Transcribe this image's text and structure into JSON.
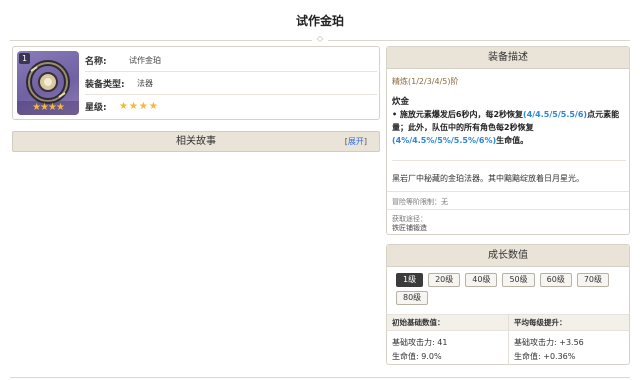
{
  "page": {
    "title": "试作金珀"
  },
  "item": {
    "rank": "1",
    "fields": [
      {
        "label": "名称:",
        "value": "试作金珀"
      },
      {
        "label": "装备类型:",
        "value": "法器"
      },
      {
        "label": "星级:",
        "value": ""
      }
    ],
    "rarity_stars": 4,
    "stars_text": "★★★★"
  },
  "story": {
    "title": "相关故事",
    "expand_open": "[",
    "expand_label": "展开",
    "expand_close": "]"
  },
  "description": {
    "header": "装备描述",
    "refinement": "精炼(1/2/3/4/5)阶",
    "passive_name": "炊金",
    "passive_parts": [
      {
        "text": "• 施放元素爆发后6秒内，每2秒恢复",
        "highlight": false
      },
      {
        "text": "(4/4.5/5/5.5/6)",
        "highlight": true
      },
      {
        "text": "点元素能量；此外，队伍中的所有角色每2秒恢复",
        "highlight": false
      },
      {
        "text": "(4%/4.5%/5%/5.5%/6%)",
        "highlight": true
      },
      {
        "text": "生命值。",
        "highlight": false
      }
    ],
    "flavor": "黑岩厂中秘藏的金珀法器。其中黯黯绽放着日月星光。",
    "ascension": "冒险等阶限制：无",
    "source_label": "获取途径：",
    "source_value": "铁匠铺锻造"
  },
  "growth": {
    "header": "成长数值",
    "levels": [
      "1级",
      "20级",
      "40级",
      "50级",
      "60级",
      "70级",
      "80级"
    ],
    "active_level": "1级",
    "base_header": "初始基础数值：",
    "growth_header": "平均每级提升：",
    "base_values": [
      "基础攻击力: 41",
      "生命值: 9.0%"
    ],
    "growth_values": [
      "基础攻击力: +3.56",
      "生命值: +0.36%"
    ]
  },
  "colors": {
    "accent_highlight": "#2d86d6",
    "star": "#f2b83a",
    "panel_header_bg": "#e9e3d8"
  }
}
